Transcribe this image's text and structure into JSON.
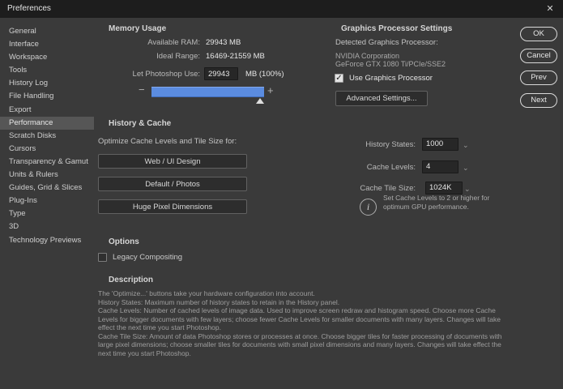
{
  "window": {
    "title": "Preferences"
  },
  "icons": {
    "close": "✕",
    "minus": "−",
    "plus": "+",
    "chevron": "⌄",
    "check": "✓",
    "info": "i"
  },
  "colors": {
    "accent_blue": "#5b8ce0",
    "dialog_bg": "#3a3a3a",
    "titlebar_bg": "#1d1d1d",
    "selected_bg": "#565656"
  },
  "sidebar": {
    "items": [
      {
        "label": "General",
        "selected": false
      },
      {
        "label": "Interface",
        "selected": false
      },
      {
        "label": "Workspace",
        "selected": false
      },
      {
        "label": "Tools",
        "selected": false
      },
      {
        "label": "History Log",
        "selected": false
      },
      {
        "label": "File Handling",
        "selected": false
      },
      {
        "label": "Export",
        "selected": false
      },
      {
        "label": "Performance",
        "selected": true
      },
      {
        "label": "Scratch Disks",
        "selected": false
      },
      {
        "label": "Cursors",
        "selected": false
      },
      {
        "label": "Transparency & Gamut",
        "selected": false
      },
      {
        "label": "Units & Rulers",
        "selected": false
      },
      {
        "label": "Guides, Grid & Slices",
        "selected": false
      },
      {
        "label": "Plug-Ins",
        "selected": false
      },
      {
        "label": "Type",
        "selected": false
      },
      {
        "label": "3D",
        "selected": false
      },
      {
        "label": "Technology Previews",
        "selected": false
      }
    ]
  },
  "memory": {
    "heading": "Memory Usage",
    "available_ram_label": "Available RAM:",
    "available_ram_value": "29943 MB",
    "ideal_range_label": "Ideal Range:",
    "ideal_range_value": "16469-21559 MB",
    "let_use_label": "Let Photoshop Use:",
    "let_use_value": "29943",
    "let_use_suffix": "MB (100%)",
    "slider_percent": "100"
  },
  "graphics": {
    "heading": "Graphics Processor Settings",
    "detected_label": "Detected Graphics Processor:",
    "vendor": "NVIDIA Corporation",
    "model": "GeForce GTX 1080 Ti/PCIe/SSE2",
    "use_gpu_label": "Use Graphics Processor",
    "use_gpu_checked": true,
    "advanced_button_label": "Advanced Settings..."
  },
  "history_cache": {
    "heading": "History & Cache",
    "optimize_label": "Optimize Cache Levels and Tile Size for:",
    "preset_buttons": [
      {
        "label": "Web / UI Design"
      },
      {
        "label": "Default / Photos"
      },
      {
        "label": "Huge Pixel Dimensions"
      }
    ],
    "history_states_label": "History States:",
    "history_states_value": "1000",
    "cache_levels_label": "Cache Levels:",
    "cache_levels_value": "4",
    "cache_tile_label": "Cache Tile Size:",
    "cache_tile_value": "1024K",
    "gpu_tip": "Set Cache Levels to 2 or higher for optimum GPU performance."
  },
  "options": {
    "heading": "Options",
    "legacy_label": "Legacy Compositing",
    "legacy_checked": false
  },
  "description": {
    "heading": "Description",
    "lines": [
      "The 'Optimize...' buttons take your hardware configuration into account.",
      "History States: Maximum number of history states to retain in the History panel.",
      "Cache Levels: Number of cached levels of image data.  Used to improve screen redraw and histogram speed.  Choose more Cache",
      "Levels for bigger documents with few layers; choose fewer Cache Levels for smaller documents with many layers. Changes will take",
      "effect the next time you start Photoshop.",
      "Cache Tile Size: Amount of data Photoshop stores or processes at once. Choose bigger tiles for faster processing of documents with",
      "large pixel dimensions; choose smaller tiles for documents with small pixel dimensions and many layers. Changes will take effect the",
      "next time you start Photoshop."
    ]
  },
  "action_buttons": {
    "ok": "OK",
    "cancel": "Cancel",
    "prev": "Prev",
    "next": "Next"
  }
}
